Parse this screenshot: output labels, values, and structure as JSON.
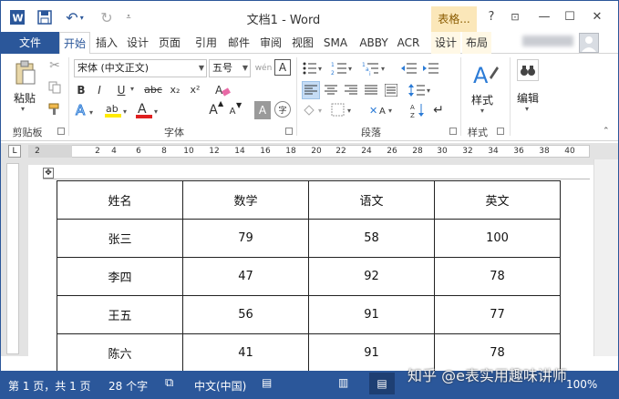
{
  "app": {
    "title": "文档1 - Word",
    "context_header": "表格...",
    "help": "?",
    "ribbon_display": "⊡",
    "minimize": "—",
    "maximize": "☐",
    "close": "✕"
  },
  "tabs": {
    "file": "文件",
    "home": "开始",
    "insert": "插入",
    "design": "设计",
    "layout": "页面",
    "references": "引用",
    "mailings": "邮件",
    "review": "审阅",
    "view": "视图",
    "sma": "SMA",
    "abby": "ABBY",
    "acr": "ACR",
    "table_design": "设计",
    "table_layout": "布局"
  },
  "ribbon": {
    "clipboard": {
      "paste": "粘贴",
      "label": "剪贴板"
    },
    "font": {
      "name": "宋体 (中文正文)",
      "size": "五号",
      "label": "字体",
      "bold": "B",
      "italic": "I",
      "underline": "U",
      "strike": "abc",
      "subscript": "x₂",
      "superscript": "x²",
      "font_color": "A",
      "grow": "A",
      "shrink": "A",
      "char_border": "A",
      "phonetic": "字",
      "wen": "wén",
      "letter_a": "A"
    },
    "paragraph": {
      "label": "段落"
    },
    "styles": {
      "button": "样式",
      "label": "样式"
    },
    "editing": {
      "button": "编辑"
    }
  },
  "ruler": {
    "ticks": [
      "2",
      "2",
      "4",
      "6",
      "8",
      "10",
      "12",
      "14",
      "16",
      "18",
      "20",
      "22",
      "24",
      "26",
      "28",
      "30",
      "32",
      "34",
      "36",
      "38",
      "40"
    ],
    "tab_selector": "L"
  },
  "table": {
    "headers": [
      "姓名",
      "数学",
      "语文",
      "英文"
    ],
    "rows": [
      [
        "张三",
        "79",
        "58",
        "100"
      ],
      [
        "李四",
        "47",
        "92",
        "78"
      ],
      [
        "王五",
        "56",
        "91",
        "77"
      ],
      [
        "陈六",
        "41",
        "91",
        "78"
      ]
    ]
  },
  "status": {
    "page": "第 1 页，共 1 页",
    "words": "28 个字",
    "language": "中文(中国)",
    "zoom": "100%"
  },
  "watermark": "知乎 @e表实用趣味讲师",
  "colors": {
    "accent": "#2b579a",
    "context": "#fbe7b9"
  }
}
